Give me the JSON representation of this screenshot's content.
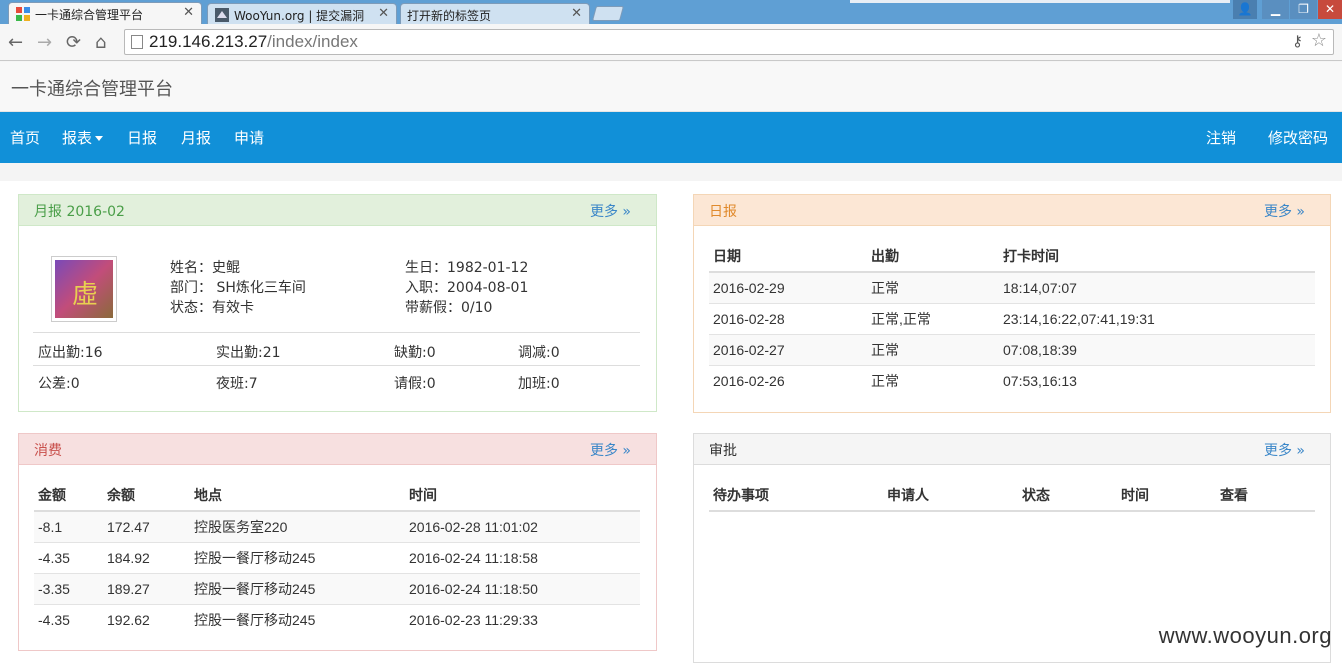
{
  "browser": {
    "tabs": [
      {
        "title": "一卡通综合管理平台",
        "active": true
      },
      {
        "title": "WooYun.org | 提交漏洞",
        "active": false
      },
      {
        "title": "打开新的标签页",
        "active": false
      }
    ],
    "url_host": "219.146.213.27",
    "url_path": "/index/index",
    "window_controls": [
      "▁",
      "❐",
      "✕"
    ]
  },
  "app": {
    "brand": "一卡通综合管理平台",
    "nav": {
      "left": [
        "首页",
        "报表",
        "日报",
        "月报",
        "申请"
      ],
      "right": [
        "注销",
        "修改密码"
      ]
    }
  },
  "monthly": {
    "title": "月报 2016-02",
    "more": "更多 »",
    "avatar_glyph": "虛",
    "name": "姓名：史鲲",
    "dept": "部门： SH炼化三车间",
    "status": "状态：有效卡",
    "birthday": "生日：1982-01-12",
    "joined": "入职：2004-08-01",
    "paid_leave": "带薪假：0/10",
    "stats_row1": [
      "应出勤:16",
      "实出勤:21",
      "缺勤:0",
      "调减:0"
    ],
    "stats_row2": [
      "公差:0",
      "夜班:7",
      "请假:0",
      "加班:0"
    ]
  },
  "daily": {
    "title": "日报",
    "more": "更多 »",
    "headers": [
      "日期",
      "出勤",
      "打卡时间"
    ],
    "rows": [
      [
        "2016-02-29",
        "正常",
        "18:14,07:07"
      ],
      [
        "2016-02-28",
        "正常,正常",
        "23:14,16:22,07:41,19:31"
      ],
      [
        "2016-02-27",
        "正常",
        "07:08,18:39"
      ],
      [
        "2016-02-26",
        "正常",
        "07:53,16:13"
      ]
    ]
  },
  "consumption": {
    "title": "消费",
    "more": "更多 »",
    "headers": [
      "金额",
      "余额",
      "地点",
      "时间"
    ],
    "rows": [
      [
        "-8.1",
        "172.47",
        "控股医务室220",
        "2016-02-28 11:01:02"
      ],
      [
        "-4.35",
        "184.92",
        "控股一餐厅移动245",
        "2016-02-24 11:18:58"
      ],
      [
        "-3.35",
        "189.27",
        "控股一餐厅移动245",
        "2016-02-24 11:18:50"
      ],
      [
        "-4.35",
        "192.62",
        "控股一餐厅移动245",
        "2016-02-23 11:29:33"
      ]
    ]
  },
  "approval": {
    "title": "审批",
    "more": "更多 »",
    "headers": [
      "待办事项",
      "申请人",
      "状态",
      "时间",
      "查看"
    ]
  },
  "watermark": "www.wooyun.org"
}
